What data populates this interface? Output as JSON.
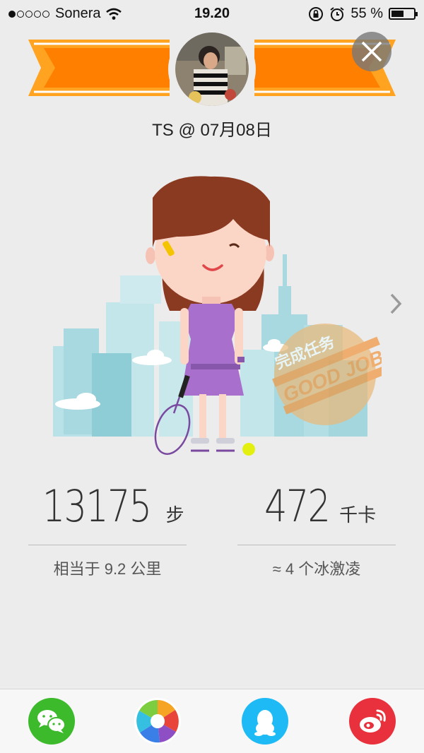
{
  "status_bar": {
    "carrier": "Sonera",
    "time": "19.20",
    "battery": "55 %",
    "battery_level": 0.55,
    "signal_dots_filled": 1,
    "signal_dots_total": 5
  },
  "header": {
    "user": "TS @ 07月08日"
  },
  "stats": {
    "steps": {
      "value": "13175",
      "unit": "步",
      "note": "相当于 9.2 公里"
    },
    "calories": {
      "value": "472",
      "unit": "千卡",
      "note": "≈ 4 个冰激凌"
    }
  },
  "stamp": {
    "text": "GOOD JOB",
    "symbol": "完成任务"
  },
  "share": [
    {
      "name": "wechat",
      "icon": "wechat-icon",
      "color": "#3dba2c"
    },
    {
      "name": "moments",
      "icon": "camera-aperture-icon",
      "color": "#ffffff"
    },
    {
      "name": "qq",
      "icon": "qq-penguin-icon",
      "color": "#1ebaf5"
    },
    {
      "name": "weibo",
      "icon": "weibo-icon",
      "color": "#e8313c"
    }
  ],
  "colors": {
    "banner": "#ff7f00",
    "banner_light": "#ffa320",
    "dress": "#a86fcd",
    "hair": "#8b3a22",
    "city": "#b7e2e7"
  }
}
